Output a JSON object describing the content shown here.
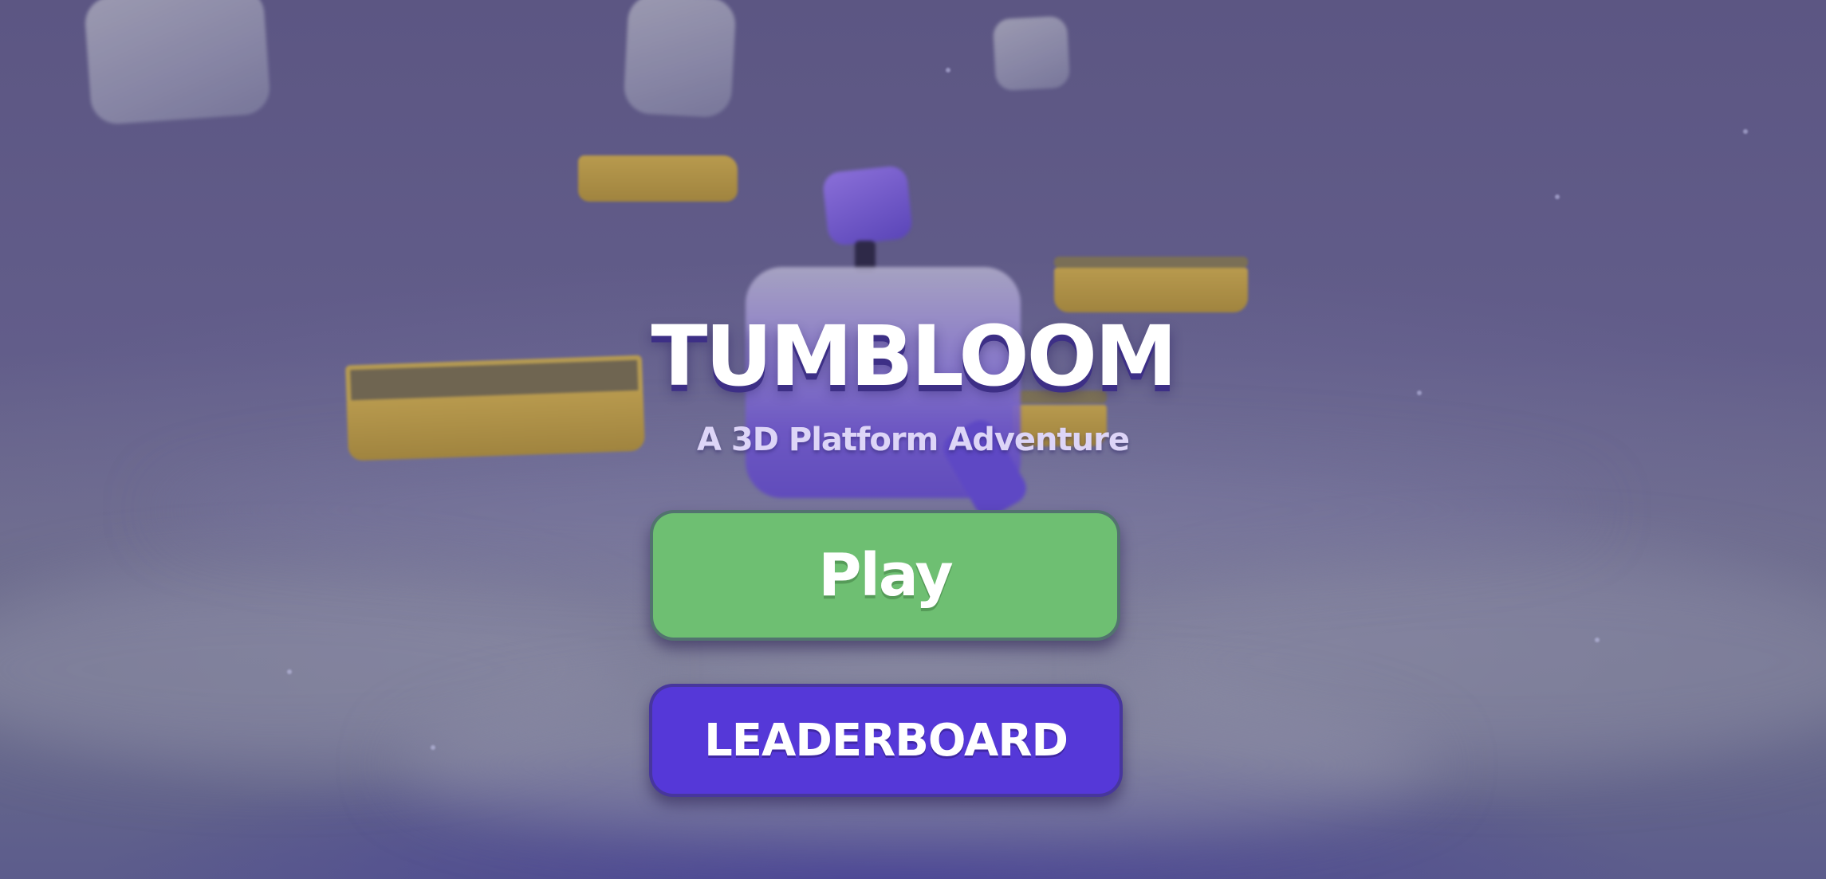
{
  "game": {
    "title": "TUMBLOOM",
    "subtitle": "A 3D Platform Adventure"
  },
  "menu": {
    "play_label": "Play",
    "leaderboard_label": "LEADERBOARD"
  },
  "colors": {
    "play_button": "#6ebf72",
    "leaderboard_button": "#5538d8",
    "title_text": "#ffffff",
    "subtitle_text": "#ddd5f7",
    "sky": "#5f5a86"
  }
}
